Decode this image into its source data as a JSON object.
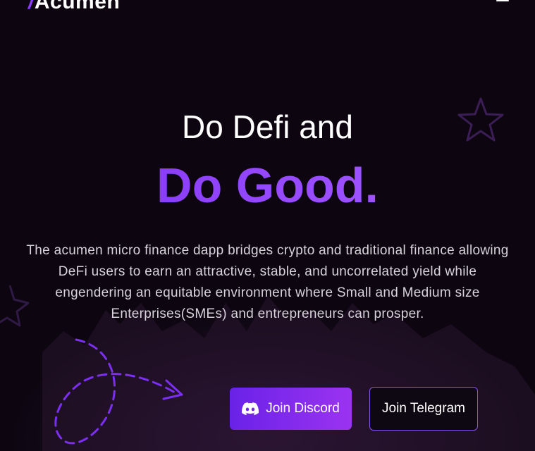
{
  "header": {
    "logo_mark": "/",
    "logo_text": "Acumen",
    "menu_icon": "hamburger-menu-icon"
  },
  "hero": {
    "title_line1": "Do Defi and",
    "title_line2": "Do Good.",
    "description": "The acumen micro finance dapp bridges crypto and traditional finance allowing DeFi users to earn an attractive, stable, and uncorrelated yield while engendering an equitable environment where Small and Medium size Enterprises(SMEs) and entrepreneurs can prosper."
  },
  "actions": {
    "discord_label": "Join Discord",
    "discord_icon": "discord-icon",
    "telegram_label": "Join Telegram"
  },
  "colors": {
    "background": "#0d0610",
    "accent": "#8a3cf2",
    "text": "#ffffff",
    "muted_text": "#d8d3da"
  }
}
